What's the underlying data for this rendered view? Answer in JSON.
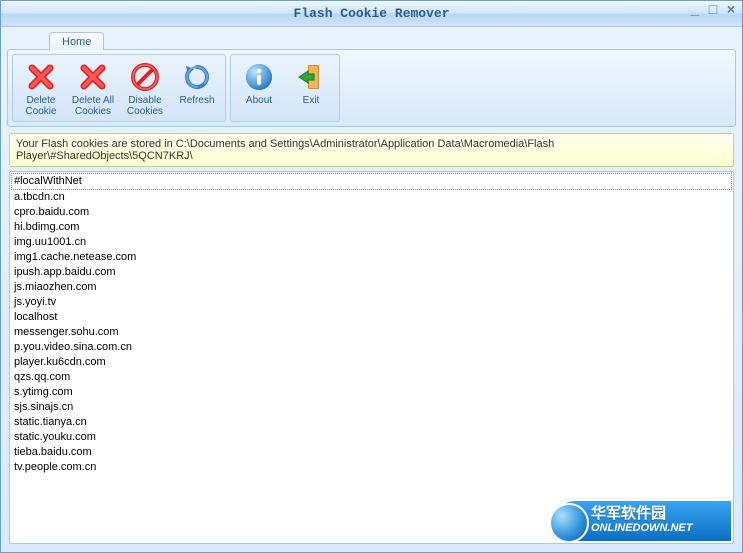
{
  "window": {
    "title": "Flash Cookie Remover"
  },
  "tabs": {
    "home": "Home"
  },
  "toolbar": {
    "delete_cookie": "Delete\nCookie",
    "delete_all": "Delete All\nCookies",
    "disable": "Disable\nCookies",
    "refresh": "Refresh",
    "about": "About",
    "exit": "Exit"
  },
  "status": {
    "text": "Your Flash cookies are stored in C:\\Documents and Settings\\Administrator\\Application Data\\Macromedia\\Flash Player\\#SharedObjects\\5QCN7KRJ\\"
  },
  "list": {
    "items": [
      "#localWithNet",
      "a.tbcdn.cn",
      "cpro.baidu.com",
      "hi.bdimg.com",
      "img.uu1001.cn",
      "img1.cache.netease.com",
      "ipush.app.baidu.com",
      "js.miaozhen.com",
      "js.yoyi.tv",
      "localhost",
      "messenger.sohu.com",
      "p.you.video.sina.com.cn",
      "player.ku6cdn.com",
      "qzs.qq.com",
      "s.ytimg.com",
      "sjs.sinajs.cn",
      "static.tianya.cn",
      "static.youku.com",
      "tieba.baidu.com",
      "tv.people.com.cn"
    ],
    "selected_index": 0
  },
  "watermark": {
    "cn": "华军软件园",
    "en": "ONLINEDOWN.NET"
  }
}
